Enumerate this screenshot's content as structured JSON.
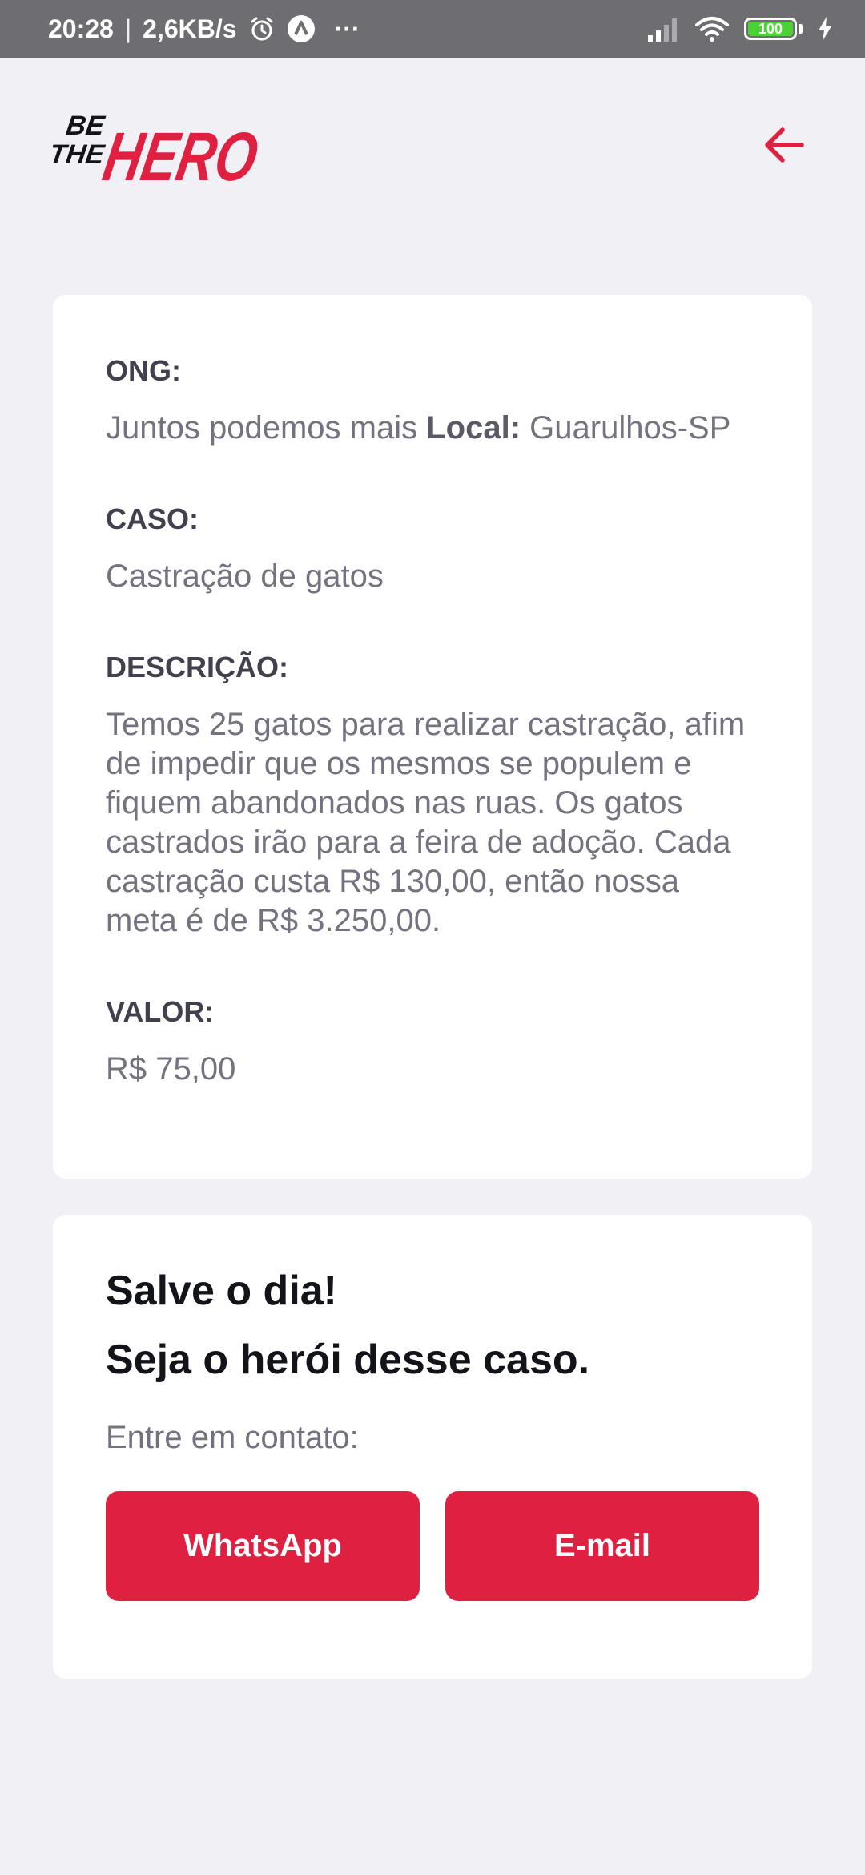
{
  "status_bar": {
    "time": "20:28",
    "separator": "|",
    "speed": "2,6KB/s",
    "more": "···",
    "battery": "100",
    "battery_color": "#4cd137"
  },
  "header": {
    "logo_be": "BE",
    "logo_the": "THE",
    "logo_hero": "HERO",
    "back_icon": "arrow-left-icon",
    "accent_color": "#e02041"
  },
  "incident": {
    "ong_label": "ONG:",
    "ong_value": "Juntos podemos mais",
    "local_label": "Local:",
    "local_value": "Guarulhos-SP",
    "case_label": "CASO:",
    "case_value": "Castração de gatos",
    "description_label": "DESCRIÇÃO:",
    "description_value": "Temos 25 gatos para realizar castração, afim de impedir que os mesmos se populem e fiquem abandonados nas ruas. Os gatos castrados irão para a feira de adoção. Cada castração custa R$ 130,00, então nossa meta é de R$ 3.250,00.",
    "value_label": "VALOR:",
    "value_value": "R$ 75,00"
  },
  "contact": {
    "title_line1": "Salve o dia!",
    "title_line2": "Seja o herói desse caso.",
    "subtitle": "Entre em contato:",
    "whatsapp_label": "WhatsApp",
    "email_label": "E-mail"
  }
}
